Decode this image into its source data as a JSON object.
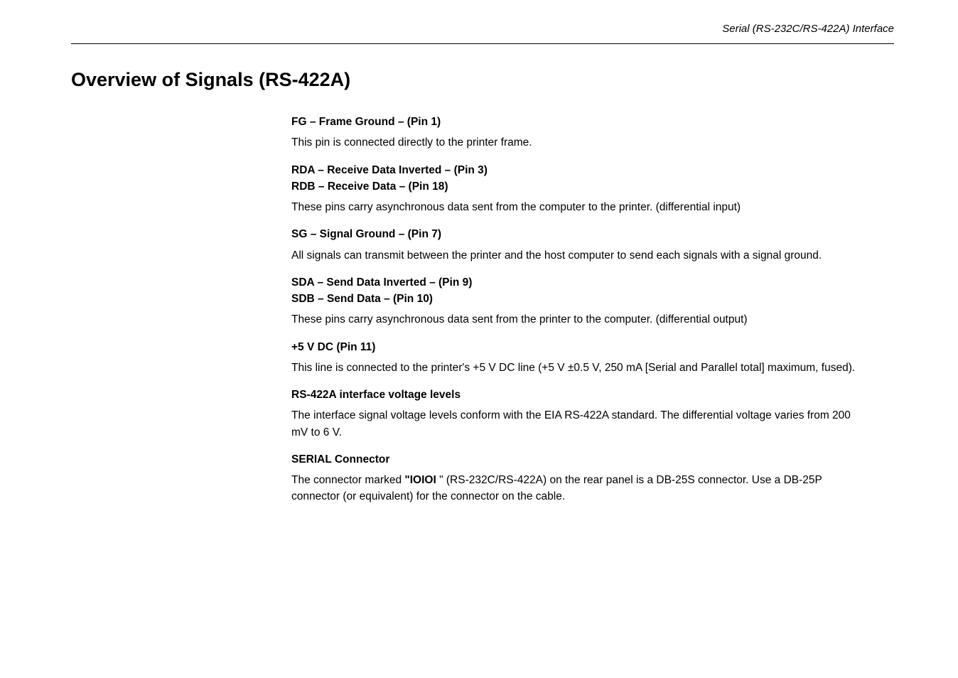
{
  "header": {
    "breadcrumb": "Serial (RS-232C/RS-422A) Interface"
  },
  "title": "Overview of Signals (RS-422A)",
  "sections": [
    {
      "heading": "FG – Frame Ground – (Pin 1)",
      "body": "This pin is connected directly to the printer frame."
    },
    {
      "heading": "RDA – Receive Data Inverted – (Pin 3)",
      "heading2": "RDB – Receive Data – (Pin 18)",
      "body": "These pins carry asynchronous data sent from the computer to the printer. (differential input)"
    },
    {
      "heading": "SG – Signal Ground – (Pin 7)",
      "body": "All signals can transmit between the printer and the host computer to send each signals with a signal ground."
    },
    {
      "heading": "SDA – Send Data Inverted – (Pin 9)",
      "heading2": "SDB – Send Data – (Pin 10)",
      "body": "These pins carry asynchronous data sent from the printer to the computer. (differential output)"
    },
    {
      "heading": "+5 V DC (Pin 11)",
      "body": "This line is connected to the printer's +5 V DC line (+5 V ±0.5 V, 250 mA [Serial and Parallel total] maximum, fused)."
    },
    {
      "heading": "RS-422A interface voltage levels",
      "body": "The interface signal voltage levels conform with the EIA RS-422A standard. The differential voltage varies from 200 mV to 6 V."
    },
    {
      "heading": "SERIAL Connector",
      "body_prefix": "The connector marked ",
      "body_bold": "\"IOIOI ",
      "body_suffix": "\" (RS-232C/RS-422A) on the rear panel is a DB-25S connector. Use a DB-25P connector (or equivalent) for the connector on the cable."
    }
  ]
}
